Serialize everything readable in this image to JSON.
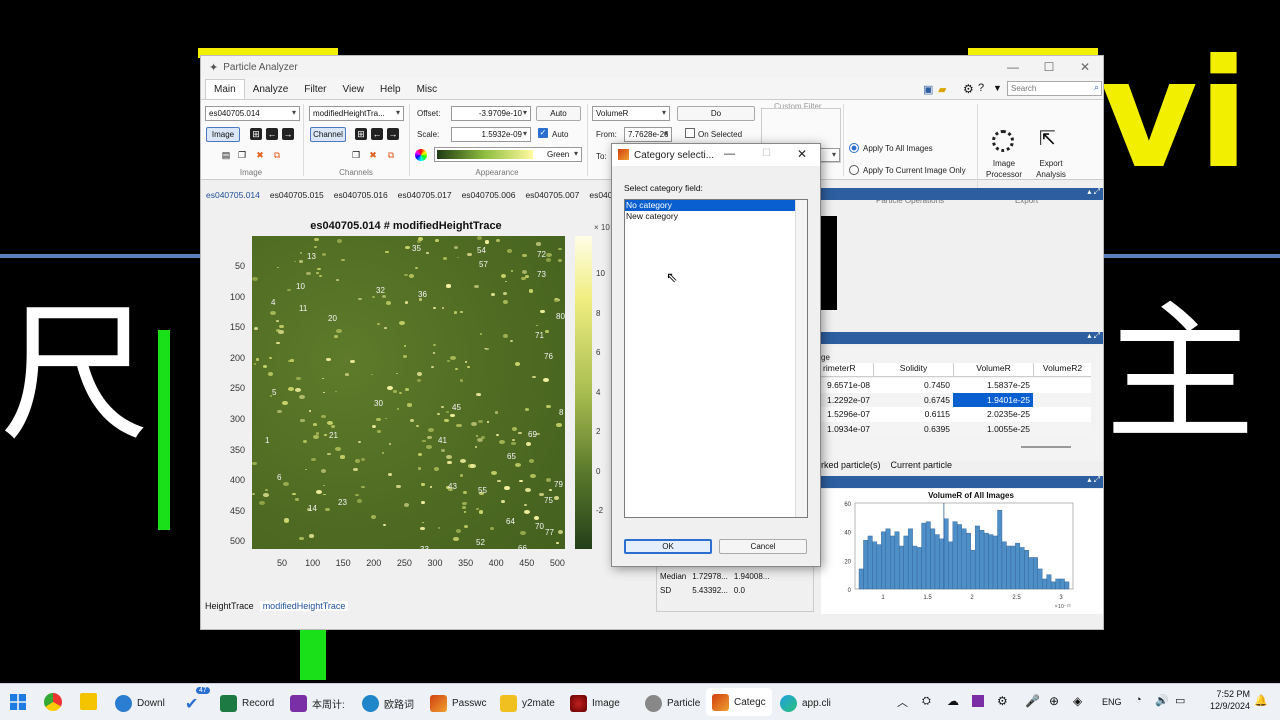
{
  "window": {
    "title": "Particle Analyzer",
    "search_placeholder": "Search"
  },
  "menu": [
    "Main",
    "Analyze",
    "Filter",
    "View",
    "Help",
    "Misc"
  ],
  "ribbon": {
    "image_select": "es040705.014",
    "image_btn": "Image",
    "group_image": "Image",
    "channel_select": "modifiedHeightTra...",
    "channel_btn": "Channel",
    "group_channels": "Channels",
    "offset_label": "Offset:",
    "offset_value": "-3.9709e-10",
    "auto_btn": "Auto",
    "scale_label": "Scale:",
    "scale_value": "1.5932e-09",
    "auto_check": "Auto",
    "colormap": "Green",
    "group_appearance": "Appearance",
    "field_select": "VolumeR",
    "do_btn": "Do",
    "from_label": "From:",
    "from_value": "7.7628e-26",
    "to_label": "To:",
    "on_selected": "On Selected",
    "custom_filter": "Custom Filter",
    "set_btn": "Set",
    "apply_all": "Apply To All Images",
    "apply_current": "Apply To Current Image Only",
    "group_ops": "Particle Operations",
    "image_processor": "Image Processor",
    "export_analysis": "Export Analysis",
    "group_export": "Export"
  },
  "image_tabs": [
    "es040705.014",
    "es040705.015",
    "es040705.016",
    "es040705.017",
    "es040705.006",
    "es040705.007",
    "es0407"
  ],
  "plot": {
    "title": "es040705.014 # modifiedHeightTrace",
    "x_ticks": [
      "50",
      "100",
      "150",
      "200",
      "250",
      "300",
      "350",
      "400",
      "450",
      "500"
    ],
    "y_ticks": [
      "50",
      "100",
      "150",
      "200",
      "250",
      "300",
      "350",
      "400",
      "450",
      "500"
    ],
    "cbar_ticks": [
      "10",
      "8",
      "6",
      "4",
      "2",
      "0",
      "-2"
    ],
    "cbar_exp": "× 10",
    "particle_labels": [
      {
        "t": "35",
        "x": 160,
        "y": 8
      },
      {
        "t": "54",
        "x": 225,
        "y": 10
      },
      {
        "t": "72",
        "x": 285,
        "y": 14
      },
      {
        "t": "13",
        "x": 55,
        "y": 16
      },
      {
        "t": "57",
        "x": 227,
        "y": 24
      },
      {
        "t": "73",
        "x": 285,
        "y": 34
      },
      {
        "t": "10",
        "x": 44,
        "y": 46
      },
      {
        "t": "32",
        "x": 124,
        "y": 50
      },
      {
        "t": "36",
        "x": 166,
        "y": 54
      },
      {
        "t": "4",
        "x": 19,
        "y": 62
      },
      {
        "t": "11",
        "x": 47,
        "y": 68
      },
      {
        "t": "20",
        "x": 76,
        "y": 78
      },
      {
        "t": "80",
        "x": 304,
        "y": 76
      },
      {
        "t": "71",
        "x": 283,
        "y": 95
      },
      {
        "t": "76",
        "x": 292,
        "y": 116
      },
      {
        "t": "5",
        "x": 20,
        "y": 152
      },
      {
        "t": "30",
        "x": 122,
        "y": 163
      },
      {
        "t": "45",
        "x": 200,
        "y": 167
      },
      {
        "t": "8",
        "x": 307,
        "y": 172
      },
      {
        "t": "1",
        "x": 13,
        "y": 200
      },
      {
        "t": "21",
        "x": 77,
        "y": 195
      },
      {
        "t": "41",
        "x": 186,
        "y": 200
      },
      {
        "t": "69",
        "x": 276,
        "y": 194
      },
      {
        "t": "65",
        "x": 255,
        "y": 216
      },
      {
        "t": "6",
        "x": 25,
        "y": 237
      },
      {
        "t": "43",
        "x": 196,
        "y": 246
      },
      {
        "t": "55",
        "x": 226,
        "y": 250
      },
      {
        "t": "79",
        "x": 302,
        "y": 244
      },
      {
        "t": "75",
        "x": 292,
        "y": 260
      },
      {
        "t": "23",
        "x": 86,
        "y": 262
      },
      {
        "t": "14",
        "x": 56,
        "y": 268
      },
      {
        "t": "64",
        "x": 254,
        "y": 281
      },
      {
        "t": "70",
        "x": 283,
        "y": 286
      },
      {
        "t": "77",
        "x": 293,
        "y": 292
      },
      {
        "t": "52",
        "x": 224,
        "y": 302
      },
      {
        "t": "33",
        "x": 168,
        "y": 309
      },
      {
        "t": "66",
        "x": 266,
        "y": 308
      }
    ]
  },
  "channel_tabs": [
    "HeightTrace",
    "modifiedHeightTrace"
  ],
  "stats": {
    "rows": [
      {
        "label": "Median",
        "v1": "1.72978...",
        "v2": "1.94008..."
      },
      {
        "label": "SD",
        "v1": "5.43392...",
        "v2": "0.0"
      }
    ]
  },
  "table": {
    "partial_header": "ge",
    "headers": [
      "rimeterR",
      "Solidity",
      "VolumeR",
      "VolumeR2"
    ],
    "rows": [
      [
        "9.6571e-08",
        "0.7450",
        "1.5837e-25"
      ],
      [
        "1.2292e-07",
        "0.6745",
        "1.9401e-25"
      ],
      [
        "1.5296e-07",
        "0.6115",
        "2.0235e-25"
      ],
      [
        "1.0934e-07",
        "0.6395",
        "1.0055e-25"
      ]
    ],
    "footer_tabs": [
      "rked particle(s)",
      "Current particle"
    ]
  },
  "histogram": {
    "title": "VolumeR of All Images",
    "x_ticks": [
      "1",
      "1.5",
      "2",
      "2.5",
      "3"
    ],
    "x_exp": "×10⁻²⁵",
    "y_ticks": [
      "60",
      "40",
      "20",
      "0"
    ],
    "chart_data": {
      "type": "bar",
      "title": "VolumeR of All Images",
      "ylim": [
        0,
        60
      ],
      "xlim": [
        0.75,
        3.1
      ],
      "values": [
        14,
        34,
        37,
        33,
        31,
        40,
        42,
        37,
        40,
        30,
        37,
        42,
        30,
        29,
        46,
        47,
        42,
        38,
        35,
        49,
        33,
        47,
        45,
        42,
        39,
        27,
        44,
        41,
        39,
        38,
        37,
        55,
        33,
        30,
        30,
        32,
        29,
        27,
        22,
        22,
        14,
        7,
        10,
        5,
        7,
        7,
        5
      ]
    }
  },
  "dialog": {
    "title": "Category selecti...",
    "prompt": "Select category field:",
    "items": [
      "No category",
      "New category"
    ],
    "ok": "OK",
    "cancel": "Cancel"
  },
  "taskbar": {
    "items": [
      "Downl",
      "Record",
      "本周计:",
      "欧路词",
      "Passwc",
      "y2mate",
      "Image",
      "Particle",
      "Categc",
      "app.cli"
    ],
    "badge": "47",
    "lang": "ENG",
    "time": "7:52 PM",
    "date": "12/9/2024"
  }
}
